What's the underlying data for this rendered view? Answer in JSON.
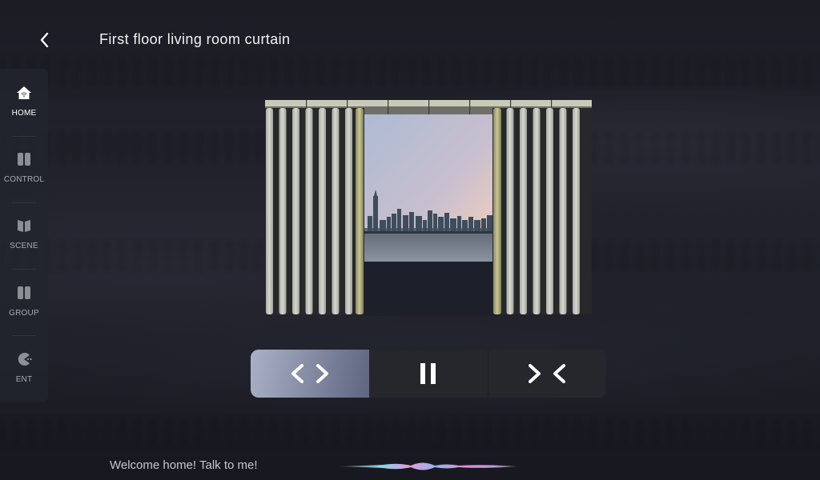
{
  "header": {
    "back_icon": "chevron-left-icon",
    "title": "First floor living room curtain"
  },
  "sidebar": {
    "items": [
      {
        "id": "home",
        "label": "HOME",
        "icon": "house-wifi-icon",
        "active": true
      },
      {
        "id": "control",
        "label": "CONTROL",
        "icon": "two-panels-icon",
        "active": false
      },
      {
        "id": "scene",
        "label": "SCENE",
        "icon": "book-open-icon",
        "active": false
      },
      {
        "id": "group",
        "label": "GROUP",
        "icon": "two-panels-icon",
        "active": false
      },
      {
        "id": "ent",
        "label": "ENT",
        "icon": "pacman-icon",
        "active": false
      }
    ]
  },
  "curtain": {
    "state": "open",
    "view": "city-skyline-window"
  },
  "controls": {
    "buttons": [
      {
        "id": "open",
        "icon": "open-arrows-icon",
        "active": true
      },
      {
        "id": "pause",
        "icon": "pause-icon",
        "active": false
      },
      {
        "id": "close",
        "icon": "close-arrows-icon",
        "active": false
      }
    ],
    "colors": {
      "active": "#9aa1b8",
      "inactive": "#25272d"
    }
  },
  "footer": {
    "welcome": "Welcome home! Talk to me!",
    "voice_icon": "voice-wave-icon"
  }
}
